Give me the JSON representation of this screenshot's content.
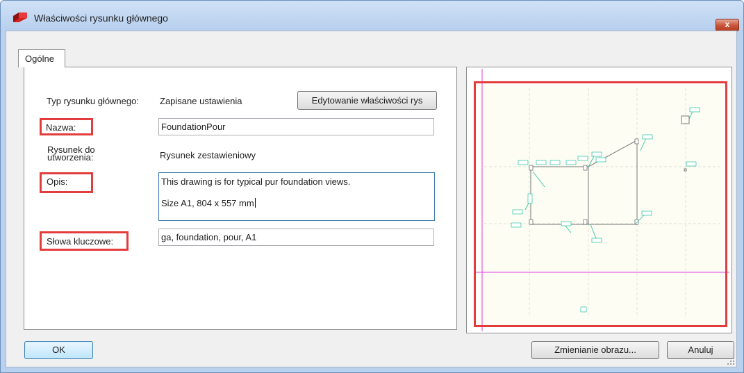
{
  "window": {
    "title": "Właściwości rysunku głównego",
    "close_label": "x"
  },
  "tabs": [
    {
      "label": "Ogólne"
    }
  ],
  "form": {
    "type_label": "Typ rysunku głównego:",
    "type_value": "Zapisane ustawienia",
    "edit_button": "Edytowanie właściwości rys",
    "name_label": "Nazwa:",
    "name_value": "FoundationPour",
    "create_label": "Rysunek do utworzenia:",
    "create_value": "Rysunek zestawieniowy",
    "description_label": "Opis:",
    "description_line1": "This drawing is for typical pur foundation views.",
    "description_line2": "Size A1, 804 x 557 mm",
    "keywords_label": "Słowa kluczowe:",
    "keywords_value": "ga, foundation, pour, A1"
  },
  "buttons": {
    "ok": "OK",
    "change_image": "Zmienianie obrazu...",
    "cancel": "Anuluj"
  },
  "colors": {
    "highlight": "#e33c3c",
    "preview_guide": "#e040e0",
    "preview_annotation": "#20c0a0"
  }
}
